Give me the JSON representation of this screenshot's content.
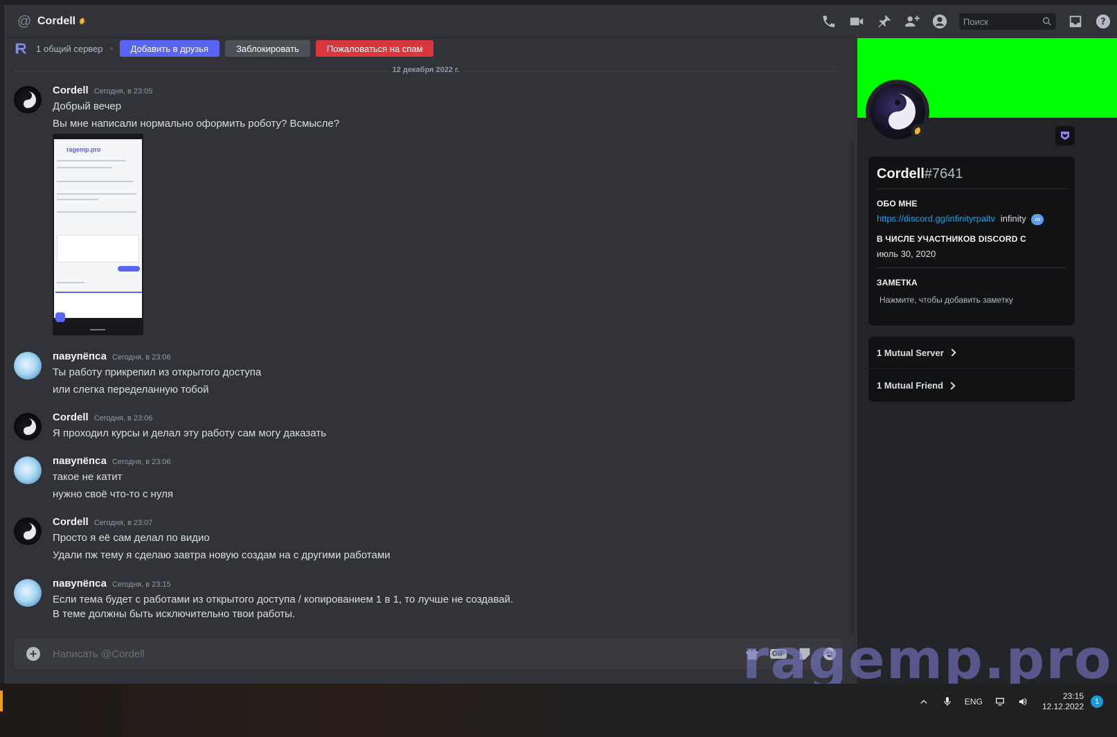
{
  "header": {
    "title": "Cordell",
    "search_placeholder": "Поиск"
  },
  "relationship": {
    "mutual_servers": "1 общий сервер",
    "add_friend": "Добавить в друзья",
    "block": "Заблокировать",
    "report_spam": "Пожаловаться на спам"
  },
  "date_divider": "12 декабря 2022 г.",
  "messages": [
    {
      "author": "Cordell",
      "time": "Сегодня, в 23:05",
      "lines": [
        "Добрый вечер",
        "Вы мне написали нормально оформить роботу?  Всмысле?"
      ]
    },
    {
      "author": "павупёпса",
      "time": "Сегодня, в 23:06",
      "lines": [
        "Ты работу прикрепил из открытого доступа",
        "или слегка переделанную тобой"
      ]
    },
    {
      "author": "Cordell",
      "time": "Сегодня, в 23:06",
      "lines": [
        "Я проходил  курсы  и делал эту работу сам могу даказать"
      ]
    },
    {
      "author": "павупёпса",
      "time": "Сегодня, в 23:06",
      "lines": [
        "такое не катит",
        "нужно своё что-то с нуля"
      ]
    },
    {
      "author": "Cordell",
      "time": "Сегодня, в 23:07",
      "lines": [
        "Просто я её сам  делал по видио",
        "Удали  пж тему я сделаю завтра новую создам на с другими работами"
      ]
    },
    {
      "author": "павупёпса",
      "time": "Сегодня, в 23:15",
      "lines": [
        "Если тема будет с работами из открытого доступа / копированием 1 в 1, то лучше не создавай.",
        "В теме должны быть исключительно твои работы."
      ]
    }
  ],
  "attachment": {
    "site": "ragemp.pro"
  },
  "composer": {
    "placeholder": "Написать @Cordell",
    "gif_label": "GIF"
  },
  "profile": {
    "username": "Cordell",
    "discriminator": "#7641",
    "about_label": "ОБО МНЕ",
    "about_link": "https://discord.gg/infinityrpaltv",
    "about_text": "infinity",
    "member_since_label": "В ЧИСЛЕ УЧАСТНИКОВ DISCORD С",
    "member_since": "июль 30, 2020",
    "note_label": "ЗАМЕТКА",
    "note_placeholder": "Нажмите, чтобы добавить заметку",
    "mutual_server": "1 Mutual Server",
    "mutual_friend": "1 Mutual Friend",
    "banner_color": "#00ff00"
  },
  "watermark": "ragemp.pro",
  "taskbar": {
    "lang": "ENG",
    "time": "23:15",
    "date": "12.12.2022",
    "notifications": "1"
  },
  "colors": {
    "accent": "#5865f2",
    "danger": "#da373c",
    "idle": "#f0b232"
  }
}
